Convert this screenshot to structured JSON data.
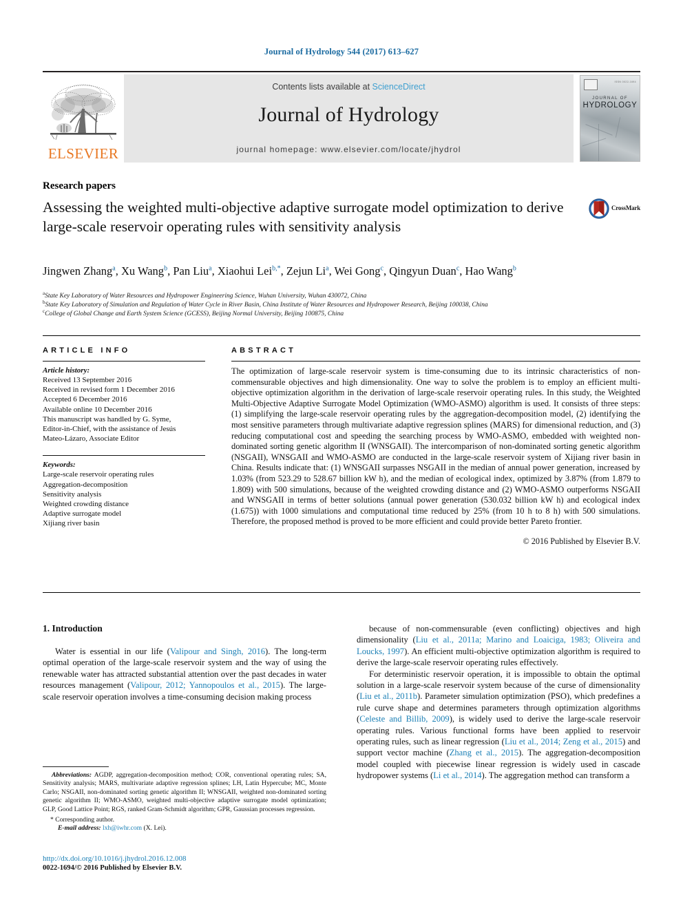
{
  "running_head": "Journal of Hydrology 544 (2017) 613–627",
  "masthead": {
    "contents_prefix": "Contents lists available at ",
    "sciencedirect_link": "ScienceDirect",
    "journal_title": "Journal of Hydrology",
    "homepage_line": "journal homepage: www.elsevier.com/locate/jhydrol",
    "publisher_logo_text": "ELSEVIER",
    "cover": {
      "line1": "JOURNAL OF",
      "line2": "HYDROLOGY",
      "corner_code": "ISSN 0022-1694"
    }
  },
  "article": {
    "section_label": "Research papers",
    "title": "Assessing the weighted multi-objective adaptive surrogate model optimization to derive large-scale reservoir operating rules with sensitivity analysis",
    "crossmark_label": "CrossMark",
    "authors_html": "Jingwen Zhang<sup>a</sup>, Xu Wang<sup>b</sup>, Pan Liu<sup>a</sup>, Xiaohui Lei<sup>b,*</sup>, Zejun Li<sup>a</sup>, Wei Gong<sup>c</sup>, Qingyun Duan<sup>c</sup>, Hao Wang<sup>b</sup>",
    "affiliations": [
      {
        "mark": "a",
        "text": "State Key Laboratory of Water Resources and Hydropower Engineering Science, Wuhan University, Wuhan 430072, China"
      },
      {
        "mark": "b",
        "text": "State Key Laboratory of Simulation and Regulation of Water Cycle in River Basin, China Institute of Water Resources and Hydropower Research, Beijing 100038, China"
      },
      {
        "mark": "c",
        "text": "College of Global Change and Earth System Science (GCESS), Beijing Normal University, Beijing 100875, China"
      }
    ]
  },
  "article_info": {
    "heading": "ARTICLE INFO",
    "history_label": "Article history:",
    "history_lines": [
      "Received 13 September 2016",
      "Received in revised form 1 December 2016",
      "Accepted 6 December 2016",
      "Available online 10 December 2016",
      "This manuscript was handled by G. Syme,",
      "Editor-in-Chief, with the assistance of Jesús",
      "Mateo-Lázaro, Associate Editor"
    ],
    "keywords_label": "Keywords:",
    "keywords": [
      "Large-scale reservoir operating rules",
      "Aggregation-decomposition",
      "Sensitivity analysis",
      "Weighted crowding distance",
      "Adaptive surrogate model",
      "Xijiang river basin"
    ]
  },
  "abstract": {
    "heading": "ABSTRACT",
    "text": "The optimization of large-scale reservoir system is time-consuming due to its intrinsic characteristics of non-commensurable objectives and high dimensionality. One way to solve the problem is to employ an efficient multi-objective optimization algorithm in the derivation of large-scale reservoir operating rules. In this study, the Weighted Multi-Objective Adaptive Surrogate Model Optimization (WMO-ASMO) algorithm is used. It consists of three steps: (1) simplifying the large-scale reservoir operating rules by the aggregation-decomposition model, (2) identifying the most sensitive parameters through multivariate adaptive regression splines (MARS) for dimensional reduction, and (3) reducing computational cost and speeding the searching process by WMO-ASMO, embedded with weighted non-dominated sorting genetic algorithm II (WNSGAII). The intercomparison of non-dominated sorting genetic algorithm (NSGAII), WNSGAII and WMO-ASMO are conducted in the large-scale reservoir system of Xijiang river basin in China. Results indicate that: (1) WNSGAII surpasses NSGAII in the median of annual power generation, increased by 1.03% (from 523.29 to 528.67 billion kW h), and the median of ecological index, optimized by 3.87% (from 1.879 to 1.809) with 500 simulations, because of the weighted crowding distance and (2) WMO-ASMO outperforms NSGAII and WNSGAII in terms of better solutions (annual power generation (530.032 billion kW h) and ecological index (1.675)) with 1000 simulations and computational time reduced by 25% (from 10 h to 8 h) with 500 simulations. Therefore, the proposed method is proved to be more efficient and could provide better Pareto frontier.",
    "copyright": "© 2016 Published by Elsevier B.V."
  },
  "introduction": {
    "heading": "1. Introduction",
    "left_paragraphs": [
      "Water is essential in our life (<span class=\"ref\">Valipour and Singh, 2016</span>). The long-term optimal operation of the large-scale reservoir system and the way of using the renewable water has attracted substantial attention over the past decades in water resources management (<span class=\"ref\">Valipour, 2012; Yannopoulos et al., 2015</span>). The large-scale reservoir operation involves a time-consuming decision making process"
    ],
    "right_paragraphs": [
      "because of non-commensurable (even conflicting) objectives and high dimensionality (<span class=\"ref\">Liu et al., 2011a; Marino and Loaiciga, 1983; Oliveira and Loucks, 1997</span>). An efficient multi-objective optimization algorithm is required to derive the large-scale reservoir operating rules effectively.",
      "For deterministic reservoir operation, it is impossible to obtain the optimal solution in a large-scale reservoir system because of the curse of dimensionality (<span class=\"ref\">Liu et al., 2011b</span>). Parameter simulation optimization (PSO), which predefines a rule curve shape and determines parameters through optimization algorithms (<span class=\"ref\">Celeste and Billib, 2009</span>), is widely used to derive the large-scale reservoir operating rules. Various functional forms have been applied to reservoir operating rules, such as linear regression (<span class=\"ref\">Liu et al., 2014; Zeng et al., 2015</span>) and support vector machine (<span class=\"ref\">Zhang et al., 2015</span>). The aggregation-decomposition model coupled with piecewise linear regression is widely used in cascade hydropower systems (<span class=\"ref\">Li et al., 2014</span>). The aggregation method can transform a"
    ]
  },
  "footnotes": {
    "abbreviations_label": "Abbreviations:",
    "abbreviations_text": " AGDP, aggregation-decomposition method; COR, conventional operating rules; SA, Sensitivity analysis; MARS, multivariate adaptive regression splines; LH, Latin Hypercube; MC, Monte Carlo; NSGAII, non-dominated sorting genetic algorithm II; WNSGAII, weighted non-dominated sorting genetic algorithm II; WMO-ASMO, weighted multi-objective adaptive surrogate model optimization; GLP, Good Lattice Point; RGS, ranked Gram-Schmidt algorithm; GPR, Gaussian processes regression.",
    "corresponding_author": "* Corresponding author.",
    "email_label": "E-mail address:",
    "email_address": "lxh@iwhr.com",
    "email_owner": "(X. Lei).",
    "doi": "http://dx.doi.org/10.1016/j.jhydrol.2016.12.008",
    "issn_line": "0022-1694/© 2016 Published by Elsevier B.V."
  },
  "colors": {
    "header_blue": "#1a6aa0",
    "link_blue": "#1a7fb5",
    "sciencedirect_blue": "#3e9fd0",
    "elsevier_orange": "#e87722",
    "masthead_grey": "#e6e6e6",
    "crossmark_blue": "#2f6eb5",
    "crossmark_red": "#b5281e"
  }
}
